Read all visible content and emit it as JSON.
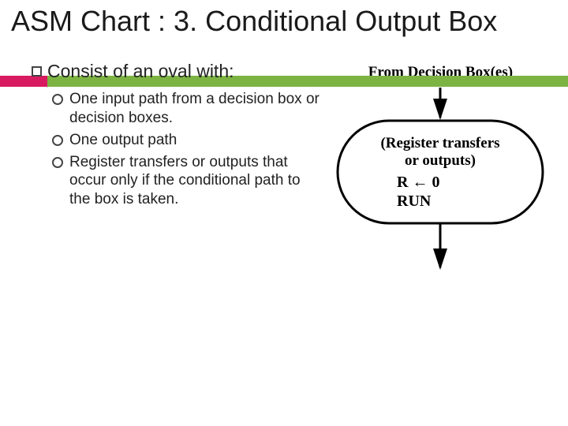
{
  "title": "ASM Chart : 3. Conditional Output Box",
  "bullets": {
    "main": "Consist of an oval with:",
    "subs": [
      "One input path from a decision box or decision boxes.",
      "One output path",
      "Register transfers or outputs that occur only if the conditional path to the box is taken."
    ]
  },
  "figure": {
    "top_label": "From Decision Box(es)",
    "inside1": "(Register transfers",
    "inside2": "or outputs)",
    "inside3": "R ← 0",
    "inside4": "RUN"
  }
}
